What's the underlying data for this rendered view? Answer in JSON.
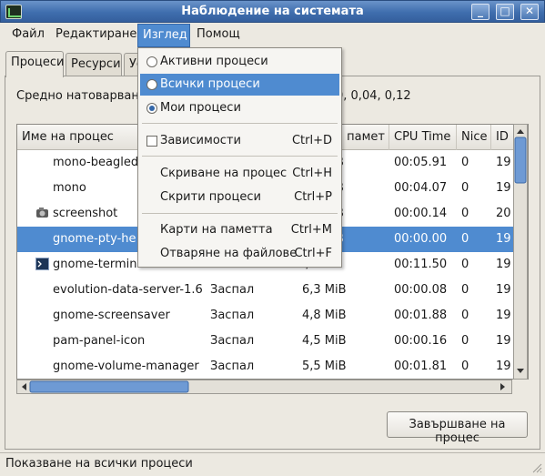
{
  "window": {
    "title": "Наблюдение на системата"
  },
  "menubar": {
    "file": "Файл",
    "edit": "Редактиране",
    "view": "Изглед",
    "help": "Помощ"
  },
  "tabs": {
    "processes": "Процеси",
    "resources": "Ресурси",
    "third": "Ус"
  },
  "load": {
    "label": "Средно натоварване",
    "values": "0, 0,04, 0,12"
  },
  "table": {
    "headers": {
      "name": "Име на процес",
      "memory": "а памет",
      "cpu": "CPU Time",
      "nice": "Nice",
      "id": "ID"
    },
    "rows": [
      {
        "name": "mono-beagled",
        "status": "",
        "memory": "B",
        "cpu": "00:05.91",
        "nice": "0",
        "id": "19"
      },
      {
        "name": "mono",
        "status": "",
        "memory": "B",
        "cpu": "00:04.07",
        "nice": "0",
        "id": "19"
      },
      {
        "name": "screenshot",
        "status": "",
        "memory": "B",
        "cpu": "00:00.14",
        "nice": "0",
        "id": "20"
      },
      {
        "name": "gnome-pty-he",
        "status": "",
        "memory": "B",
        "cpu": "00:00.00",
        "nice": "0",
        "id": "19"
      },
      {
        "name": "gnome-terminal",
        "status": "Заспал",
        "memory": "10,1 MiB",
        "cpu": "00:11.50",
        "nice": "0",
        "id": "19"
      },
      {
        "name": "evolution-data-server-1.6",
        "status": "Заспал",
        "memory": "6,3 MiB",
        "cpu": "00:00.08",
        "nice": "0",
        "id": "19"
      },
      {
        "name": "gnome-screensaver",
        "status": "Заспал",
        "memory": "4,8 MiB",
        "cpu": "00:01.88",
        "nice": "0",
        "id": "19"
      },
      {
        "name": "pam-panel-icon",
        "status": "Заспал",
        "memory": "4,5 MiB",
        "cpu": "00:00.16",
        "nice": "0",
        "id": "19"
      },
      {
        "name": "gnome-volume-manager",
        "status": "Заспал",
        "memory": "5,5 MiB",
        "cpu": "00:01.81",
        "nice": "0",
        "id": "19"
      }
    ]
  },
  "view_menu": {
    "active": "Активни процеси",
    "all": "Всички процеси",
    "mine": "Мои процеси",
    "deps": "Зависимости",
    "deps_acc": "Ctrl+D",
    "hide": "Скриване на процес",
    "hide_acc": "Ctrl+H",
    "hidden": "Скрити процеси",
    "hidden_acc": "Ctrl+P",
    "memmaps": "Карти на паметта",
    "memmaps_acc": "Ctrl+M",
    "openfiles": "Отваряне на файлове",
    "openfiles_acc": "Ctrl+F"
  },
  "end_button": "Завършване на процес",
  "status": "Показване на всички процеси",
  "colors": {
    "accent": "#4f8bd0",
    "titlebar": "#3f6eae"
  }
}
